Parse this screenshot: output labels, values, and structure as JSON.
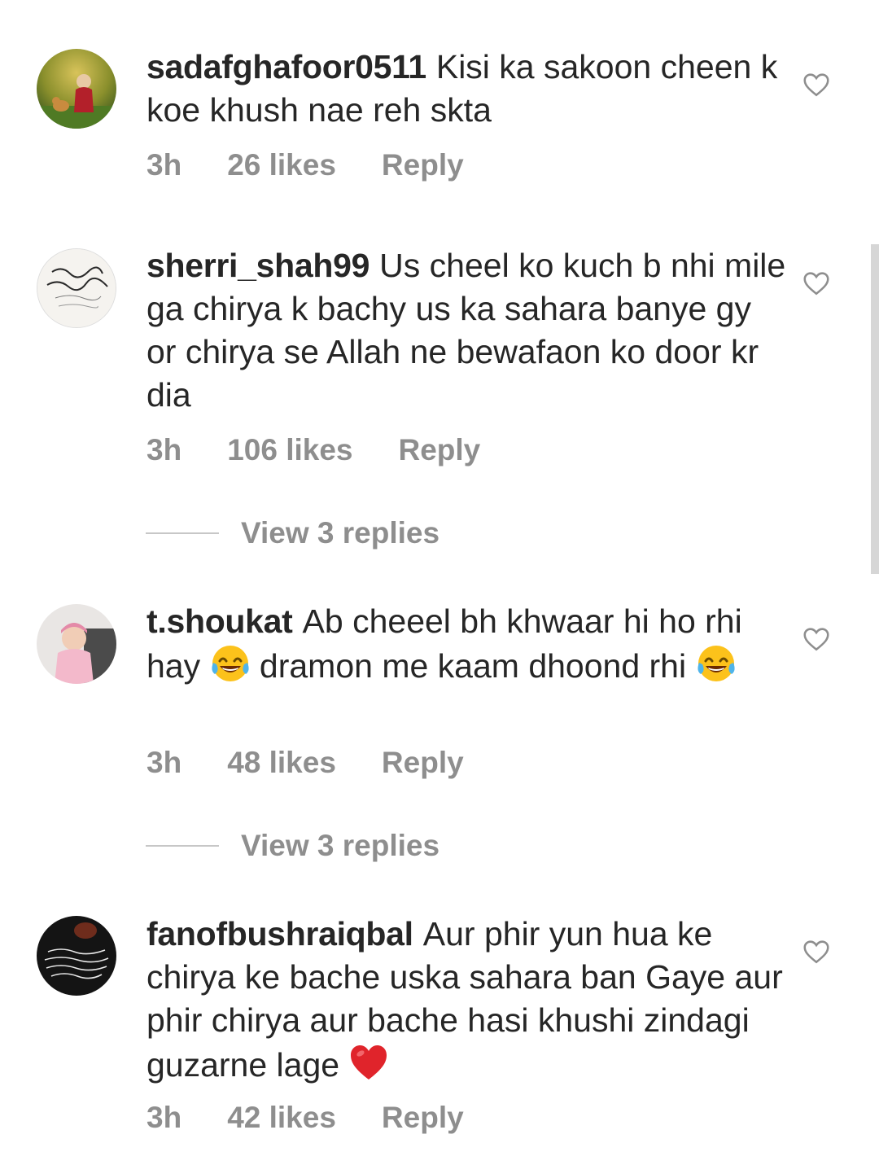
{
  "comments": [
    {
      "username": "sadafghafoor0511",
      "text": "Kisi ka sakoon cheen k koe khush nae reh skta",
      "time": "3h",
      "likes": "26 likes",
      "reply": "Reply",
      "avatar": "child-with-cat-photo"
    },
    {
      "username": "sherri_shah99",
      "text": "Us cheel ko kuch b nhi mile ga chirya k bachy us ka sahara banye gy or chirya se Allah ne bewafaon ko door kr dia",
      "time": "3h",
      "likes": "106 likes",
      "reply": "Reply",
      "avatar": "arabic-calligraphy-image",
      "view_replies": "View 3 replies"
    },
    {
      "username": "t.shoukat",
      "text_part1": "Ab cheeel bh khwaar hi ho rhi hay",
      "text_part2": "dramon me kaam dhoond rhi",
      "time": "3h",
      "likes": "48 likes",
      "reply": "Reply",
      "avatar": "baby-photo",
      "view_replies": "View 3 replies"
    },
    {
      "username": "fanofbushraiqbal",
      "text": "Aur phir yun hua ke chirya ke bache uska sahara ban Gaye aur phir chirya aur bache hasi khushi zindagi guzarne lage",
      "time": "3h",
      "likes": "42 likes",
      "reply": "Reply",
      "avatar": "urdu-poetry-image"
    }
  ],
  "colors": {
    "text": "#262626",
    "secondary": "#8e8e8e",
    "divider": "#c7c7c7",
    "heart_outline": "#8e8e8e",
    "red_heart": "#e0242b"
  },
  "icons": {
    "like": "heart-outline-icon",
    "laugh": "face-with-tears-of-joy-emoji",
    "love": "red-heart-emoji"
  }
}
